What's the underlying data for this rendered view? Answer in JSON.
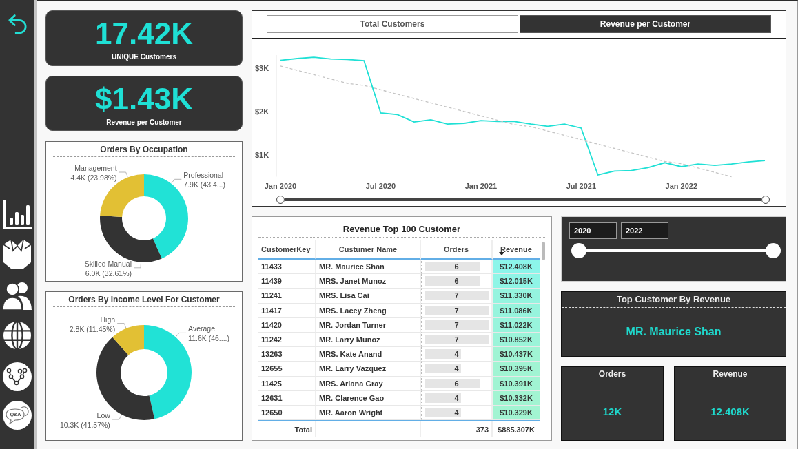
{
  "nav": {
    "qa_button": "Q&A"
  },
  "kpis": [
    {
      "value": "17.42K",
      "label": "UNIQUE Customers"
    },
    {
      "value": "$1.43K",
      "label": "Revenue per Customer"
    }
  ],
  "trend_panel": {
    "tabs": [
      {
        "label": "Total Customers",
        "selected": false
      },
      {
        "label": "Revenue per Customer",
        "selected": true
      }
    ],
    "chart_data": {
      "type": "line",
      "categories": [
        "Jan 2020",
        null,
        null,
        null,
        null,
        null,
        "Jul 2020",
        null,
        null,
        null,
        null,
        null,
        "Jan 2021",
        null,
        null,
        null,
        null,
        null,
        "Jul 2021",
        null,
        null,
        null,
        null,
        null,
        "Jan 2022",
        null,
        null,
        null,
        null,
        null
      ],
      "ylim": [
        500,
        3300
      ],
      "yticks": [
        {
          "value": 1000,
          "label": "$1K"
        },
        {
          "value": 2000,
          "label": "$2K"
        },
        {
          "value": 3000,
          "label": "$3K"
        }
      ],
      "series": [
        {
          "color": "#1fe0d5",
          "line_style": "solid",
          "values": [
            3180,
            3220,
            3250,
            3210,
            3200,
            3170,
            1970,
            1930,
            1760,
            1810,
            1710,
            1730,
            1790,
            1770,
            1770,
            1710,
            1660,
            1710,
            1620,
            540,
            630,
            640,
            710,
            820,
            730,
            790,
            760,
            790,
            840,
            870
          ]
        },
        {
          "color": "#c4c4c4",
          "line_style": "dashed",
          "values": [
            3050,
            2950,
            2850,
            2750,
            2650,
            2600,
            2500,
            2400,
            2300,
            2200,
            2100,
            2000,
            1900,
            1800,
            1700,
            1650,
            1550,
            1450,
            1350,
            1250,
            1150,
            1050,
            950,
            850,
            800,
            700,
            600,
            500,
            null,
            null
          ]
        }
      ]
    },
    "range_slider": {
      "level": 1
    }
  },
  "occupation_chart": {
    "chart_data": {
      "type": "donut",
      "title": "Orders By Occupation",
      "categories": [
        "Professional",
        "Skilled Manual",
        "Management"
      ],
      "values": [
        43.41,
        32.61,
        23.98
      ],
      "colors": [
        "#21e2d6",
        "#333333",
        "#e2c034"
      ],
      "value_labels": [
        "7.9K (43.4...)",
        "6.0K (32.61%)",
        "4.4K (23.98%)"
      ]
    }
  },
  "income_chart": {
    "chart_data": {
      "type": "donut",
      "title": "Orders By Income Level For Customer",
      "categories": [
        "Average",
        "Low",
        "High"
      ],
      "values": [
        46,
        41.57,
        11.45
      ],
      "colors": [
        "#21e2d6",
        "#333333",
        "#e2c034"
      ],
      "value_labels": [
        "11.6K (46....)",
        "10.3K (41.57%)",
        "2.8K (11.45%)"
      ]
    }
  },
  "table": {
    "title": "Revenue Top 100 Customer",
    "columns": [
      {
        "label": "CustomerKey",
        "sorted": false
      },
      {
        "label": "Custumer Name",
        "sorted": false
      },
      {
        "label": "Orders",
        "sorted": false
      },
      {
        "label": "Revenue",
        "sorted": true
      }
    ],
    "rows": [
      {
        "customer_key": "11433",
        "name": "MR. Maurice Shan",
        "orders": "6",
        "level": 0.86,
        "revenue": "$12.408K",
        "color": "#8cf5ea"
      },
      {
        "customer_key": "11439",
        "name": "MRS. Janet Munoz",
        "orders": "6",
        "level": 0.86,
        "revenue": "$12.015K",
        "color": "#8ff5e6"
      },
      {
        "customer_key": "11241",
        "name": "MRS. Lisa Cai",
        "orders": "7",
        "level": 1,
        "revenue": "$11.330K",
        "color": "#95f4df"
      },
      {
        "customer_key": "11417",
        "name": "MRS. Lacey Zheng",
        "orders": "7",
        "level": 1,
        "revenue": "$11.086K",
        "color": "#97f4dd"
      },
      {
        "customer_key": "11420",
        "name": "MR. Jordan Turner",
        "orders": "7",
        "level": 1,
        "revenue": "$11.022K",
        "color": "#98f4dc"
      },
      {
        "customer_key": "11242",
        "name": "MR. Larry Munoz",
        "orders": "7",
        "level": 1,
        "revenue": "$10.852K",
        "color": "#9bf4d9"
      },
      {
        "customer_key": "13263",
        "name": "MRS. Kate Anand",
        "orders": "4",
        "level": 0.57,
        "revenue": "$10.437K",
        "color": "#a0f4d4"
      },
      {
        "customer_key": "12655",
        "name": "MR. Larry Vazquez",
        "orders": "4",
        "level": 0.57,
        "revenue": "$10.395K",
        "color": "#a1f4d3"
      },
      {
        "customer_key": "11425",
        "name": "MRS. Ariana Gray",
        "orders": "6",
        "level": 0.86,
        "revenue": "$10.391K",
        "color": "#a1f4d3"
      },
      {
        "customer_key": "12631",
        "name": "MR. Clarence Gao",
        "orders": "4",
        "level": 0.57,
        "revenue": "$10.332K",
        "color": "#a2f4d2"
      },
      {
        "customer_key": "12650",
        "name": "MR. Aaron Wright",
        "orders": "4",
        "level": 0.57,
        "revenue": "$10.329K",
        "color": "#a2f4d2"
      }
    ],
    "total": {
      "label": "Total",
      "orders": "373",
      "revenue": "$885.307K"
    }
  },
  "year_slicer": {
    "from": "2020",
    "to": "2022",
    "level": 1
  },
  "top_customer": {
    "title": "Top Customer By Revenue",
    "value": "MR. Maurice Shan"
  },
  "cards": [
    {
      "title": "Orders",
      "value": "12K"
    },
    {
      "title": "Revenue",
      "value": "12.408K"
    }
  ]
}
